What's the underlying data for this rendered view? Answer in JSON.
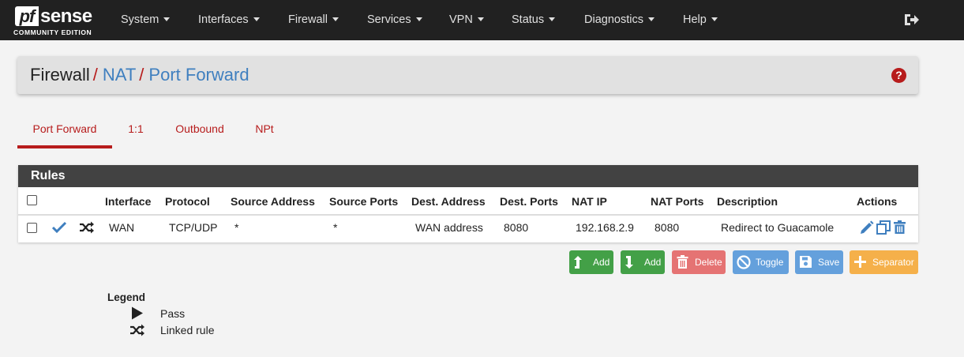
{
  "brand": {
    "logo_text": "pfsense",
    "edition": "COMMUNITY EDITION"
  },
  "nav": {
    "items": [
      {
        "label": "System"
      },
      {
        "label": "Interfaces"
      },
      {
        "label": "Firewall"
      },
      {
        "label": "Services"
      },
      {
        "label": "VPN"
      },
      {
        "label": "Status"
      },
      {
        "label": "Diagnostics"
      },
      {
        "label": "Help"
      }
    ],
    "logout_icon": "logout-icon"
  },
  "breadcrumb": {
    "root": "Firewall",
    "section": "NAT",
    "page": "Port Forward",
    "separator": "/"
  },
  "help_icon": "?",
  "tabs": [
    {
      "label": "Port Forward",
      "active": true
    },
    {
      "label": "1:1",
      "active": false
    },
    {
      "label": "Outbound",
      "active": false
    },
    {
      "label": "NPt",
      "active": false
    }
  ],
  "rules": {
    "title": "Rules",
    "columns": [
      "Interface",
      "Protocol",
      "Source Address",
      "Source Ports",
      "Dest. Address",
      "Dest. Ports",
      "NAT IP",
      "NAT Ports",
      "Description",
      "Actions"
    ],
    "rows": [
      {
        "interface": "WAN",
        "protocol": "TCP/UDP",
        "source_address": "*",
        "source_ports": "*",
        "dest_address": "WAN address",
        "dest_ports": "8080",
        "nat_ip": "192.168.2.9",
        "nat_ports": "8080",
        "description": "Redirect to Guacamole"
      }
    ]
  },
  "buttons": {
    "add_top": "Add",
    "add_bottom": "Add",
    "delete": "Delete",
    "toggle": "Toggle",
    "save": "Save",
    "separator": "Separator"
  },
  "legend": {
    "title": "Legend",
    "pass": "Pass",
    "linked": "Linked rule"
  },
  "colors": {
    "navbar": "#212121",
    "accent_red": "#b71c1c",
    "link_blue": "#3f7fbf",
    "green": "#43a047",
    "danger": "#e57373",
    "info": "#64a0dc",
    "warning": "#f5b04a"
  }
}
